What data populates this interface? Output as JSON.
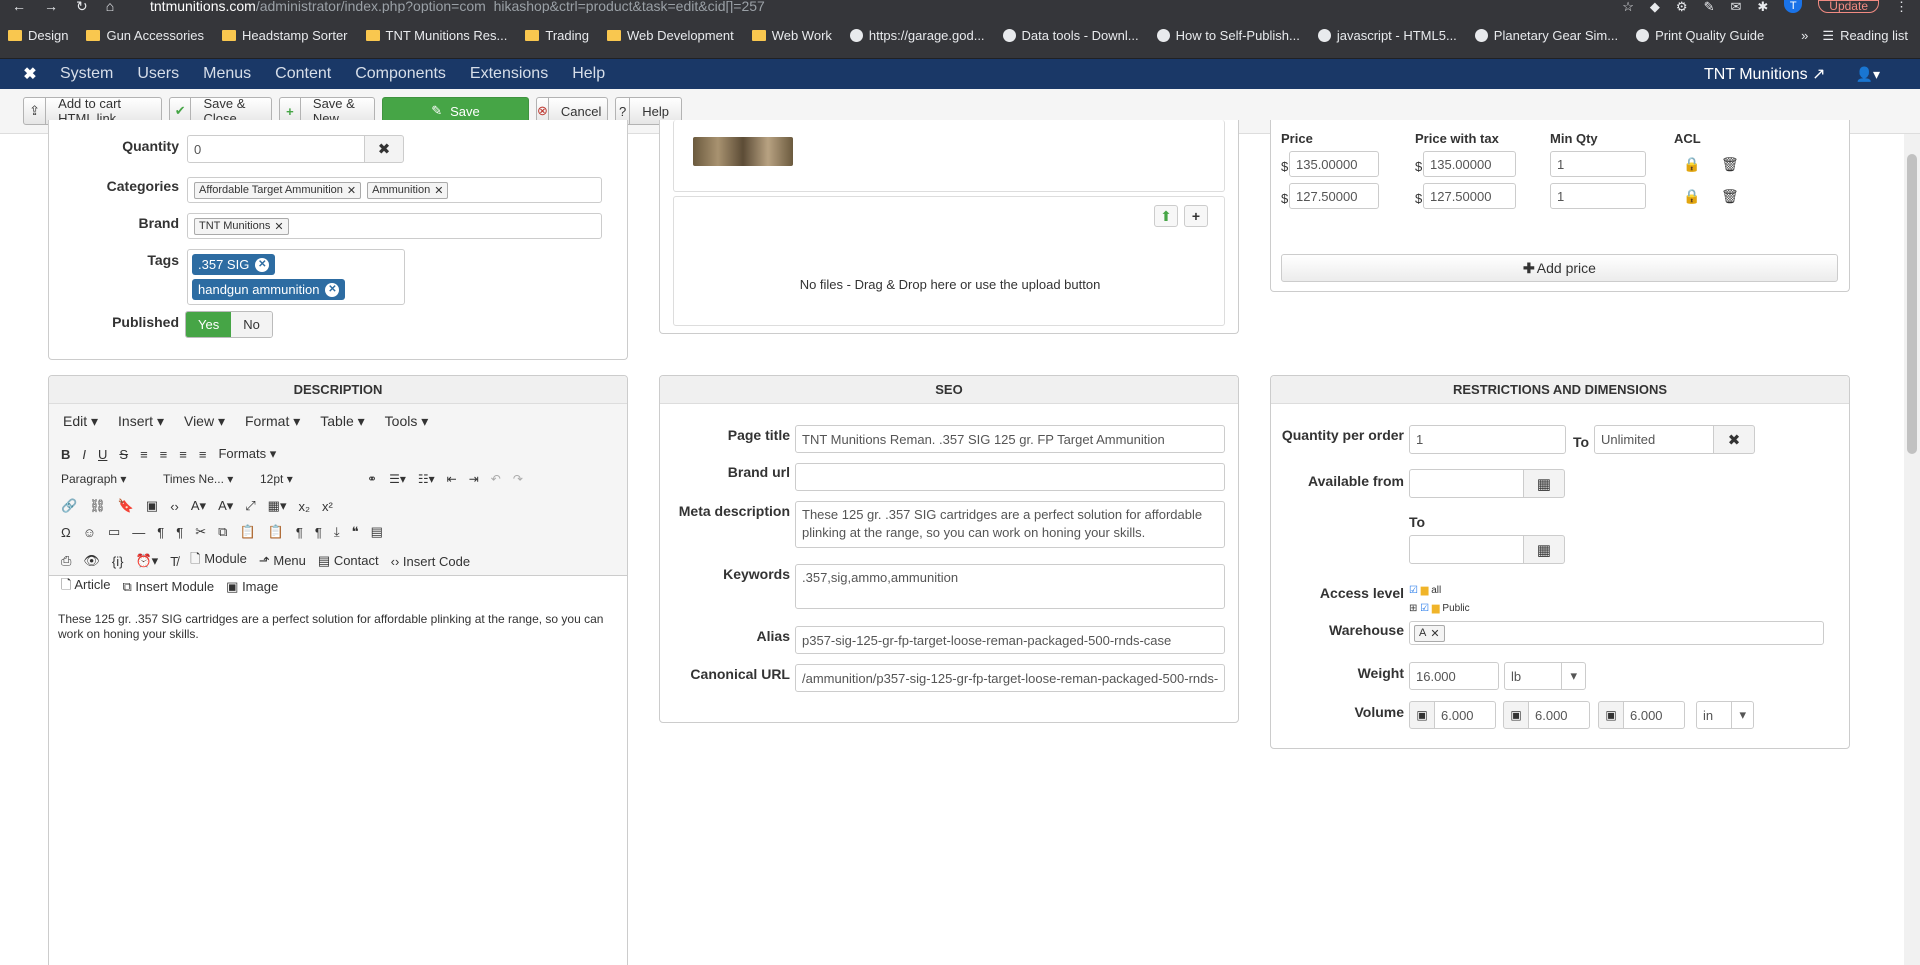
{
  "browser": {
    "url_host": "tntmunitions.com",
    "url_path": "/administrator/index.php?option=com_hikashop&ctrl=product&task=edit&cid[]=257",
    "update_label": "Update",
    "avatar_letter": "T",
    "bookmarks": [
      {
        "label": "Design",
        "kind": "folder"
      },
      {
        "label": "Gun Accessories",
        "kind": "folder"
      },
      {
        "label": "Headstamp Sorter",
        "kind": "folder"
      },
      {
        "label": "TNT Munitions Res...",
        "kind": "folder"
      },
      {
        "label": "Trading",
        "kind": "folder"
      },
      {
        "label": "Web Development",
        "kind": "folder"
      },
      {
        "label": "Web Work",
        "kind": "folder"
      },
      {
        "label": "https://garage.god...",
        "kind": "site"
      },
      {
        "label": "Data tools - Downl...",
        "kind": "site"
      },
      {
        "label": "How to Self-Publish...",
        "kind": "site"
      },
      {
        "label": "javascript - HTML5...",
        "kind": "site"
      },
      {
        "label": "Planetary Gear Sim...",
        "kind": "site"
      },
      {
        "label": "Print Quality Guide",
        "kind": "site"
      }
    ],
    "more": "»",
    "reading_list": "Reading list"
  },
  "joomla_nav": {
    "items": [
      "System",
      "Users",
      "Menus",
      "Content",
      "Components",
      "Extensions",
      "Help"
    ],
    "site_name": "TNT Munitions"
  },
  "toolbar": {
    "add_to_cart": "Add to cart HTML link",
    "save_close": "Save & Close",
    "save_new": "Save & New",
    "save": "Save",
    "cancel": "Cancel",
    "help": "Help"
  },
  "general": {
    "quantity_label": "Quantity",
    "quantity_value": "0",
    "categories_label": "Categories",
    "categories": [
      "Affordable Target Ammunition",
      "Ammunition"
    ],
    "brand_label": "Brand",
    "brand": "TNT Munitions",
    "tags_label": "Tags",
    "tags": [
      ".357 SIG",
      "handgun ammunition"
    ],
    "published_label": "Published",
    "yes": "Yes",
    "no": "No"
  },
  "images": {
    "dropzone_text": "No files - Drag & Drop here or use the upload button"
  },
  "prices": {
    "headers": [
      "Price",
      "Price with tax",
      "Min Qty",
      "ACL"
    ],
    "currency": "$",
    "rows": [
      {
        "price": "135.00000",
        "price_tax": "135.00000",
        "min_qty": "1"
      },
      {
        "price": "127.50000",
        "price_tax": "127.50000",
        "min_qty": "1"
      }
    ],
    "add_price": "Add price"
  },
  "description": {
    "title": "DESCRIPTION",
    "menu": [
      "Edit",
      "Insert",
      "View",
      "Format",
      "Table",
      "Tools"
    ],
    "formats": "Formats",
    "block": "Paragraph",
    "font": "Times Ne...",
    "size": "12pt",
    "buttons": {
      "module": "Module",
      "menu": "Menu",
      "contact": "Contact",
      "insert_code": "Insert Code",
      "article": "Article",
      "insert_module": "Insert Module",
      "image": "Image"
    },
    "body": "These 125 gr. .357 SIG cartridges are a perfect solution for affordable plinking at the range, so you can work on honing your skills."
  },
  "seo": {
    "title": "SEO",
    "page_title_label": "Page title",
    "page_title": "TNT Munitions Reman. .357 SIG 125 gr. FP Target Ammunition",
    "brand_url_label": "Brand url",
    "brand_url": "",
    "meta_label": "Meta description",
    "meta": "These 125 gr. .357 SIG cartridges are a perfect solution for affordable plinking at the range, so you can work on honing your skills.",
    "keywords_label": "Keywords",
    "keywords": ".357,sig,ammo,ammunition",
    "alias_label": "Alias",
    "alias": "p357-sig-125-gr-fp-target-loose-reman-packaged-500-rnds-case",
    "canonical_label": "Canonical URL",
    "canonical": "/ammunition/p357-sig-125-gr-fp-target-loose-reman-packaged-500-rnds-"
  },
  "restrictions": {
    "title": "RESTRICTIONS AND DIMENSIONS",
    "qty_label": "Quantity per order",
    "qty_min": "1",
    "to": "To",
    "qty_max": "Unlimited",
    "available_label": "Available from",
    "to_label": "To",
    "access_label": "Access level",
    "access_all": "all",
    "access_public": "Public",
    "warehouse_label": "Warehouse",
    "warehouse_chip": "A",
    "weight_label": "Weight",
    "weight": "16.000",
    "weight_unit": "lb",
    "volume_label": "Volume",
    "volume": [
      "6.000",
      "6.000",
      "6.000"
    ],
    "volume_unit": "in"
  }
}
